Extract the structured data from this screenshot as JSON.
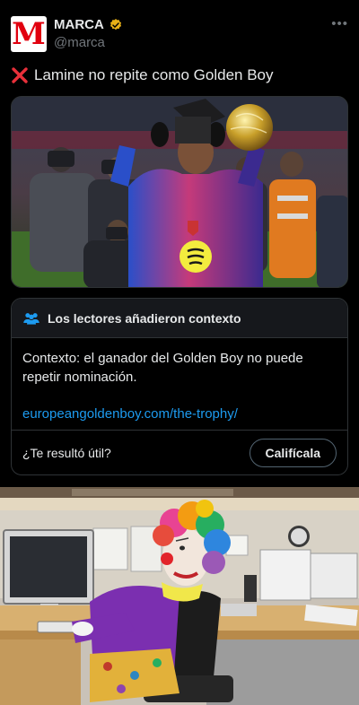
{
  "account": {
    "display_name": "MARCA",
    "handle": "@marca",
    "avatar_letter": "M",
    "verified": true
  },
  "tweet": {
    "text": "Lamine no repite como Golden Boy",
    "leading_icon": "cross-mark-icon"
  },
  "community_note": {
    "title": "Los lectores añadieron contexto",
    "text": "Contexto: el ganador del Golden Boy no puede repetir nominación.",
    "link": "europeangoldenboy.com/the-trophy/",
    "helpful_question": "¿Te resultó útil?",
    "rate_label": "Califícala"
  },
  "colors": {
    "background": "#000000",
    "text": "#e7e9ea",
    "muted": "#71767b",
    "link": "#1d9bf0",
    "border": "#2f3336",
    "brand": "#e1000f",
    "verified": "#e8b017"
  }
}
